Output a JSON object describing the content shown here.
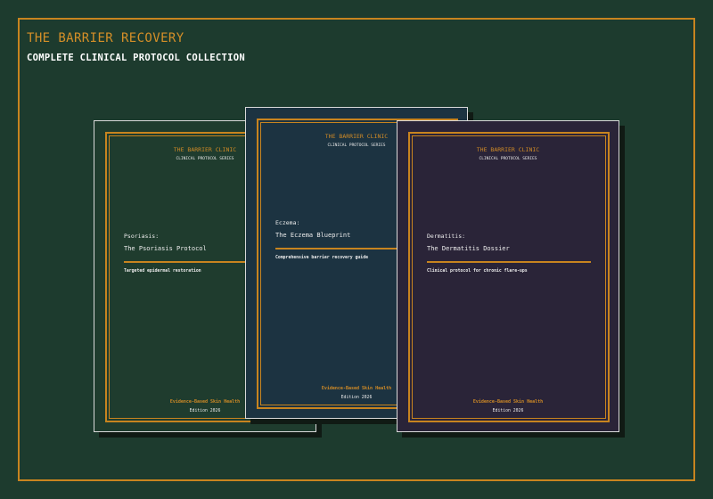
{
  "header": {
    "title": "THE BARRIER RECOVERY",
    "subtitle": "COMPLETE CLINICAL PROTOCOL COLLECTION"
  },
  "books": [
    {
      "publisher": "THE BARRIER CLINIC",
      "series": "CLINICAL PROTOCOL SERIES",
      "condition": "Psoriasis:",
      "title": "The Psoriasis Protocol",
      "tagline": "Targeted epidermal restoration",
      "footer": "Evidence-Based Skin Health",
      "edition": "Edition 2026",
      "cover_color": "#1f3c2e"
    },
    {
      "publisher": "THE BARRIER CLINIC",
      "series": "CLINICAL PROTOCOL SERIES",
      "condition": "Eczema:",
      "title": "The Eczema Blueprint",
      "tagline": "Comprehensive barrier recovery guide",
      "footer": "Evidence-Based Skin Health",
      "edition": "Edition 2026",
      "cover_color": "#1c3341"
    },
    {
      "publisher": "THE BARRIER CLINIC",
      "series": "CLINICAL PROTOCOL SERIES",
      "condition": "Dermatitis:",
      "title": "The Dermatitis Dossier",
      "tagline": "Clinical protocol for chronic flare-ups",
      "footer": "Evidence-Based Skin Health",
      "edition": "Edition 2026",
      "cover_color": "#2a2438"
    }
  ],
  "colors": {
    "background": "#1d3b2e",
    "accent": "#c8841f"
  }
}
